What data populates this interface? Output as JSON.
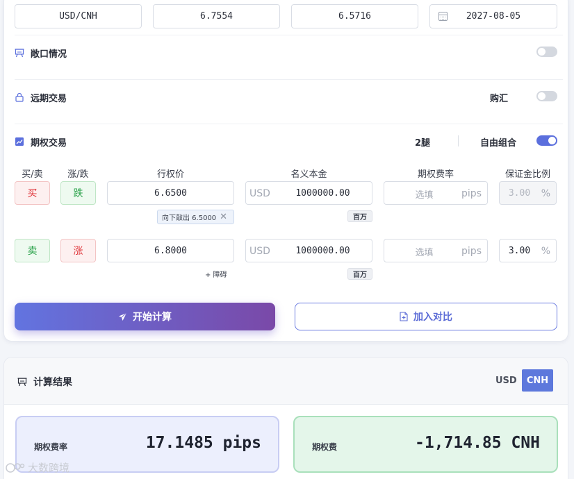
{
  "top_fields": {
    "currency_pair": "USD/CNH",
    "rate_1": "6.7554",
    "rate_2": "6.5716",
    "date": "2027-08-05"
  },
  "sections": {
    "exposure": {
      "title": "敞口情况",
      "icon": "presentation-icon",
      "enabled": false
    },
    "forward": {
      "title": "远期交易",
      "icon": "lock-icon",
      "side_label": "购汇",
      "enabled": false
    },
    "options": {
      "title": "期权交易",
      "icon": "trend-chart-icon",
      "legs_label": "2腿",
      "combo_label": "自由组合",
      "enabled": true
    }
  },
  "columns": {
    "side": "买/卖",
    "direction": "涨/跌",
    "strike": "行权价",
    "notional": "名义本金",
    "premium_rate": "期权费率",
    "margin_ratio": "保证金比例"
  },
  "legs": [
    {
      "side": "买",
      "direction": "跌",
      "strike": "6.6500",
      "notional_currency": "USD",
      "notional": "1000000.00",
      "notional_unit": "百万",
      "premium_placeholder": "选填",
      "premium_unit": "pips",
      "margin": "3.00",
      "margin_unit": "%",
      "barrier_tag": "向下敲出 6.5000"
    },
    {
      "side": "卖",
      "direction": "涨",
      "strike": "6.8000",
      "notional_currency": "USD",
      "notional": "1000000.00",
      "notional_unit": "百万",
      "premium_placeholder": "选填",
      "premium_unit": "pips",
      "margin": "3.00",
      "margin_unit": "%",
      "add_barrier": "+ 障碍"
    }
  ],
  "actions": {
    "calculate": "开始计算",
    "compare": "加入对比"
  },
  "results": {
    "title": "计算结果",
    "currency_options": [
      "USD",
      "CNH"
    ],
    "selected_currency": "CNH",
    "premium_rate_label": "期权费率",
    "premium_rate_value": "17.1485 pips",
    "premium_label": "期权费",
    "premium_value": "-1,714.85 CNH"
  },
  "watermark": "大数跨境",
  "colors": {
    "accent": "#5b6fdd",
    "gradient_start": "#6274e0",
    "gradient_end": "#7a49a8",
    "buy_red": "#e0393e",
    "sell_green": "#2aa24a"
  }
}
